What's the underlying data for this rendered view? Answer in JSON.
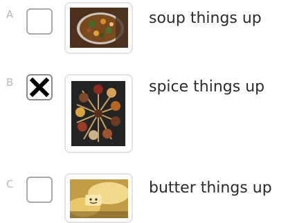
{
  "options": [
    {
      "letter": "A",
      "label": "soup things up",
      "checked": false,
      "image": "soup-photo"
    },
    {
      "letter": "B",
      "label": "spice things up",
      "checked": true,
      "image": "spices-photo"
    },
    {
      "letter": "C",
      "label": "butter things up",
      "checked": false,
      "image": "butter-photo"
    }
  ],
  "colors": {
    "letter": "#b9b9b9",
    "label": "#2b2b2b",
    "checkbox_border": "#a8a8a8",
    "card_border": "#e3e3e3",
    "check_mark": "#000000"
  },
  "icons": {
    "check_mark": "x-mark-icon"
  }
}
